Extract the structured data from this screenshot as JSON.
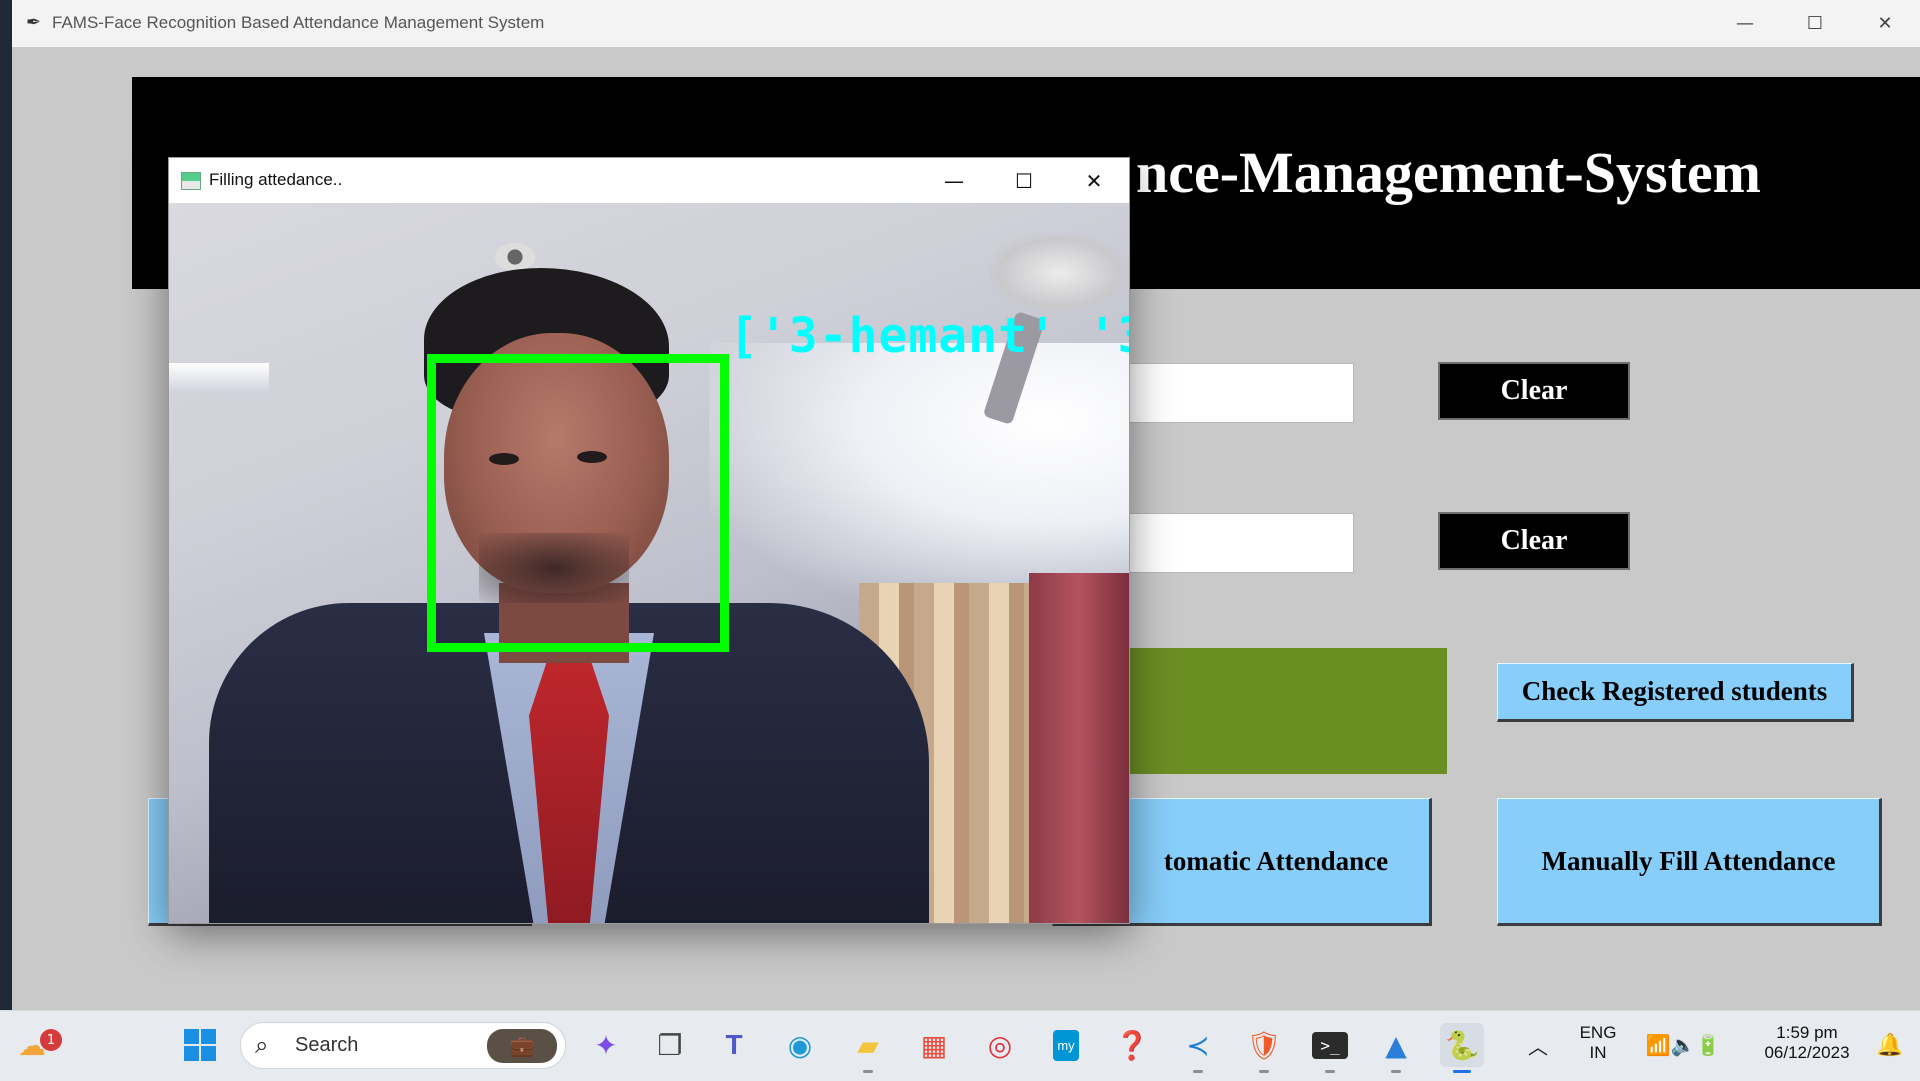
{
  "main_window": {
    "title": "FAMS-Face Recognition Based Attendance Management System",
    "header_text": "nce-Management-System",
    "clear_label_1": "Clear",
    "clear_label_2": "Clear",
    "check_registered_label": "Check Registered students",
    "automatic_attendance_label": "tomatic Attendance",
    "manual_attendance_label": "Manually Fill Attendance"
  },
  "camera_window": {
    "title": "Filling attedance..",
    "face_label": "['3-hemant' '3-"
  },
  "taskbar": {
    "search_placeholder": "Search",
    "weather_badge": "1",
    "language_line1": "ENG",
    "language_line2": "IN",
    "time": "1:59 pm",
    "date": "06/12/2023"
  },
  "colors": {
    "header_bg": "#000000",
    "button_blue": "#87cefa",
    "green_block": "#6b8e23",
    "face_box": "#00ff00",
    "face_label": "#00ffff"
  },
  "icons": [
    "feather-icon",
    "minimize-icon",
    "maximize-icon",
    "close-icon",
    "start-icon",
    "search-icon",
    "copilot-icon",
    "task-view-icon",
    "teams-icon",
    "edge-icon",
    "file-explorer-icon",
    "store-icon",
    "app-red-icon",
    "myhp-icon",
    "help-icon",
    "vscode-icon",
    "brave-icon",
    "terminal-icon",
    "photos-icon",
    "python-icon",
    "chevron-up-icon",
    "wifi-icon",
    "volume-icon",
    "battery-icon",
    "bell-icon"
  ]
}
